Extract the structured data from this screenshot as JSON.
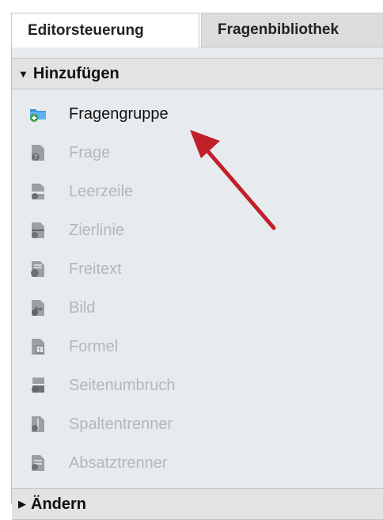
{
  "tabs": [
    {
      "label": "Editorsteuerung",
      "active": true
    },
    {
      "label": "Fragenbibliothek",
      "active": false
    }
  ],
  "panel": {
    "section_add": {
      "title": "Hinzufügen",
      "expanded": true
    },
    "items": [
      {
        "label": "Fragengruppe",
        "icon": "folder-add-icon",
        "enabled": true
      },
      {
        "label": "Frage",
        "icon": "question-doc-icon",
        "enabled": false
      },
      {
        "label": "Leerzeile",
        "icon": "blank-line-doc-icon",
        "enabled": false
      },
      {
        "label": "Zierlinie",
        "icon": "decorative-line-doc-icon",
        "enabled": false
      },
      {
        "label": "Freitext",
        "icon": "free-text-doc-icon",
        "enabled": false
      },
      {
        "label": "Bild",
        "icon": "image-doc-icon",
        "enabled": false
      },
      {
        "label": "Formel",
        "icon": "formula-doc-icon",
        "enabled": false
      },
      {
        "label": "Seitenumbruch",
        "icon": "page-break-icon",
        "enabled": false
      },
      {
        "label": "Spaltentrenner",
        "icon": "column-separator-icon",
        "enabled": false
      },
      {
        "label": "Absatztrenner",
        "icon": "paragraph-separator-icon",
        "enabled": false
      }
    ],
    "section_change": {
      "title": "Ändern",
      "expanded": false
    }
  },
  "colors": {
    "arrow": "#c0202a",
    "disabled_text": "#b3b7ba",
    "panel_bg": "#e8ebee"
  }
}
